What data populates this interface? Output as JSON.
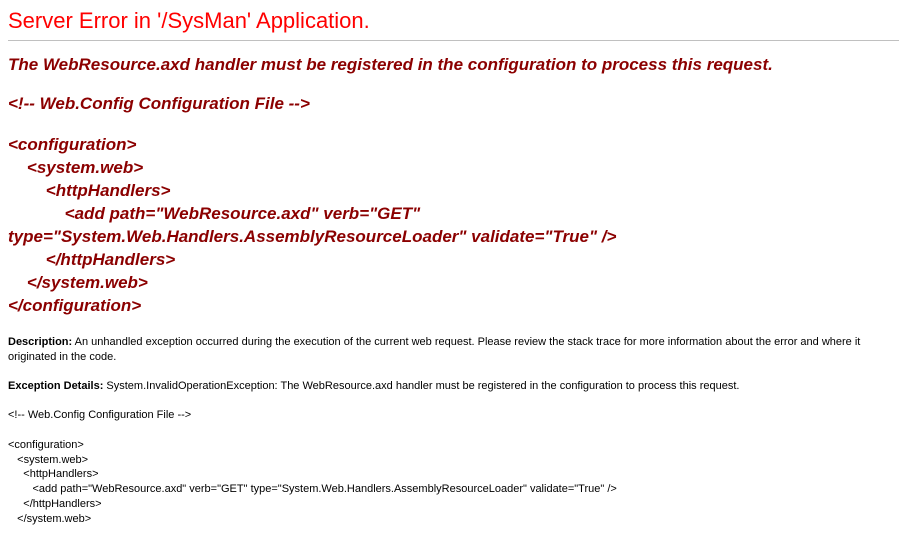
{
  "title": "Server Error in '/SysMan' Application.",
  "subhead": "The WebResource.axd handler must be registered in the configuration to process this request.",
  "config_comment": "<!-- Web.Config Configuration File -->",
  "config_lines": {
    "l1": "<configuration>",
    "l2": "    <system.web>",
    "l3": "        <httpHandlers>",
    "l4": "            <add path=\"WebResource.axd\" verb=\"GET\"",
    "l5": "type=\"System.Web.Handlers.AssemblyResourceLoader\" validate=\"True\" />",
    "l6": "        </httpHandlers>",
    "l7": "    </system.web>",
    "l8": "</configuration>"
  },
  "description": {
    "label": "Description:",
    "text": " An unhandled exception occurred during the execution of the current web request. Please review the stack trace for more information about the error and where it originated in the code."
  },
  "exception": {
    "label": "Exception Details:",
    "text": " System.InvalidOperationException: The WebResource.axd handler must be registered in the configuration to process this request."
  },
  "small_config": {
    "comment": "<!-- Web.Config Configuration File -->",
    "l1": "<configuration>",
    "l2": "   <system.web>",
    "l3": "     <httpHandlers>",
    "l4": "        <add path=\"WebResource.axd\" verb=\"GET\" type=\"System.Web.Handlers.AssemblyResourceLoader\" validate=\"True\" />",
    "l5": "     </httpHandlers>",
    "l6": "   </system.web>"
  }
}
